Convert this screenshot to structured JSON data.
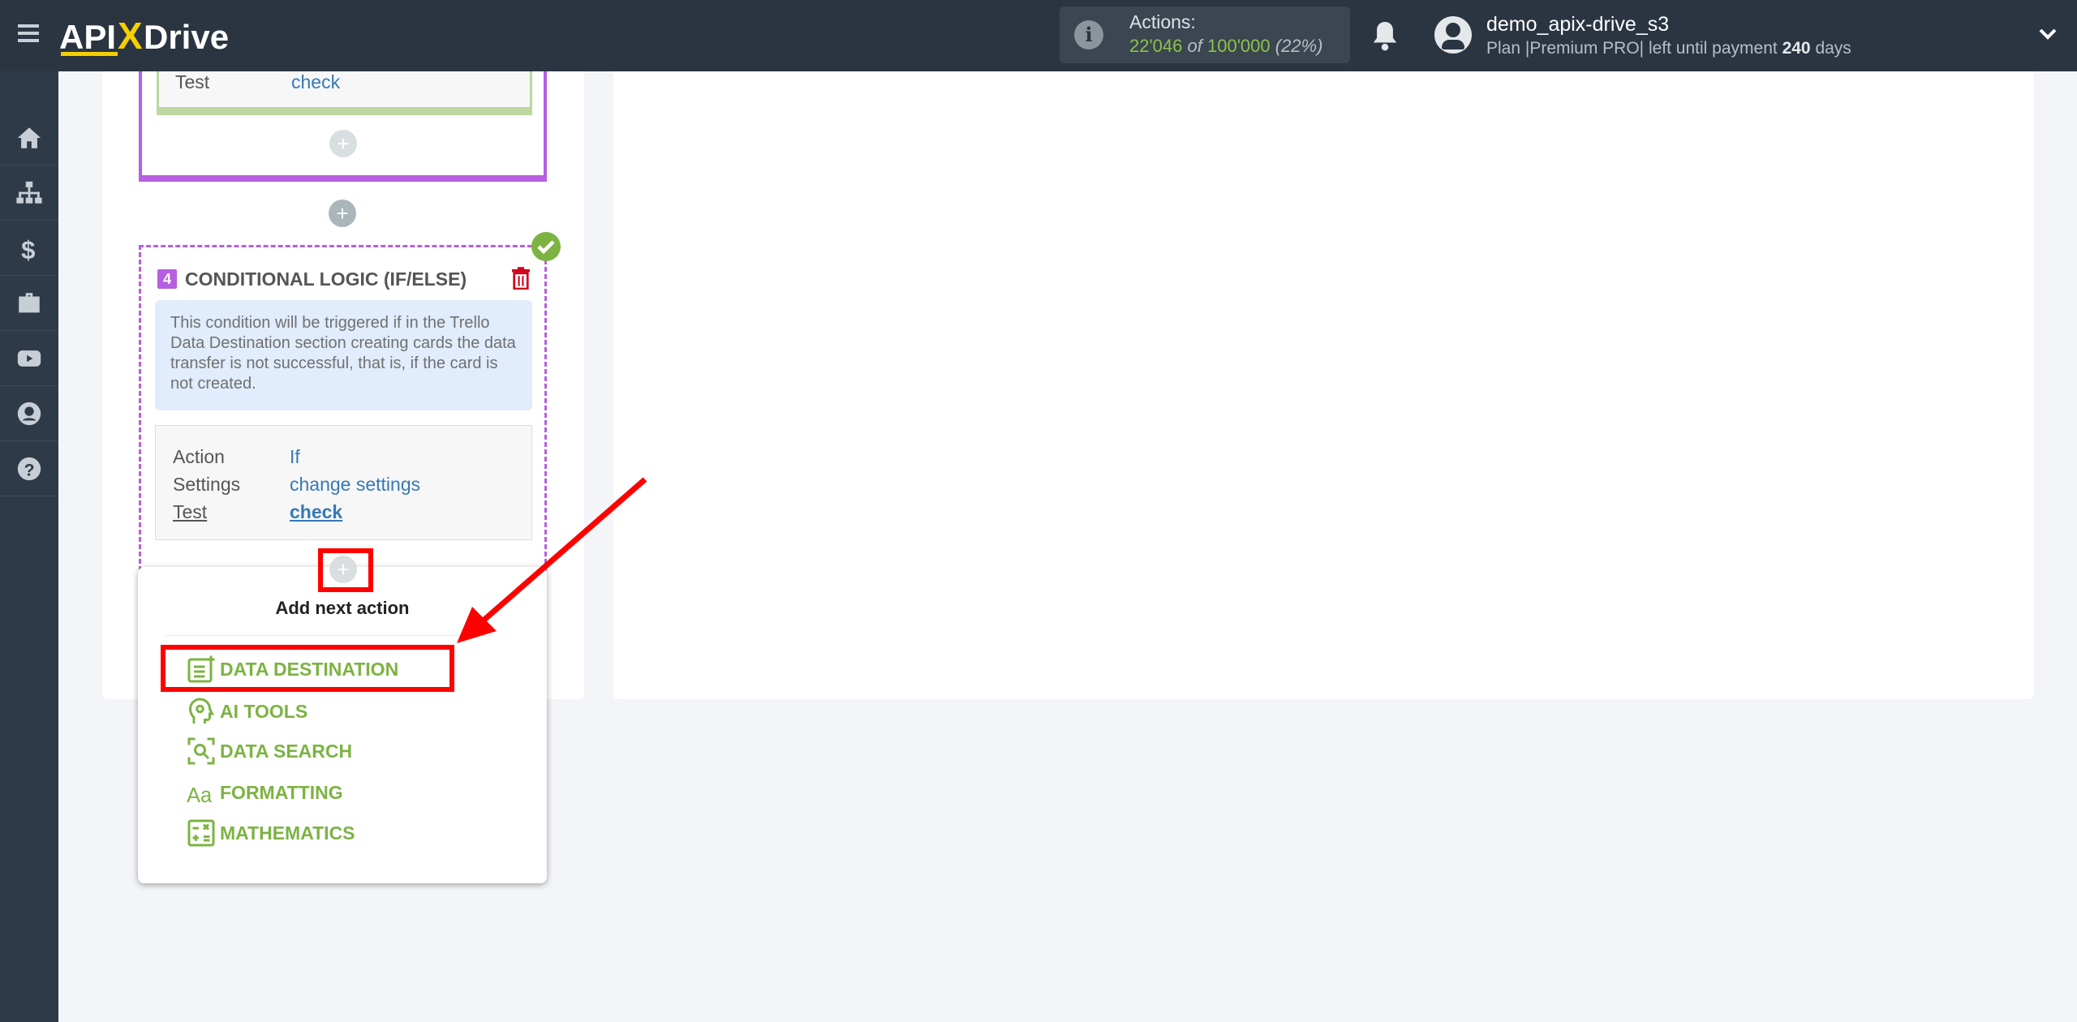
{
  "header": {
    "logo": "APIXDrive",
    "actions_label": "Actions:",
    "actions_used": "22'046",
    "actions_of": "of",
    "actions_total": "100'000",
    "actions_pct": "(22%)",
    "username": "demo_apix-drive_s3",
    "plan_prefix": "Plan |Premium PRO| left until payment",
    "plan_days": "240",
    "plan_suffix": "days"
  },
  "sidebar": {
    "items": [
      "home",
      "sitemap",
      "billing",
      "briefcase",
      "youtube",
      "account",
      "help"
    ]
  },
  "prev_block": {
    "test_label": "Test",
    "test_value": "check"
  },
  "block": {
    "number": "4",
    "title": "CONDITIONAL LOGIC (IF/ELSE)",
    "description": "This condition will be triggered if in the Trello Data Destination section creating cards the data transfer is not successful, that is, if the card is not created.",
    "rows": [
      {
        "label": "Action",
        "value": "If"
      },
      {
        "label": "Settings",
        "value": "change settings"
      },
      {
        "label": "Test",
        "value": "check"
      }
    ]
  },
  "popup": {
    "title": "Add next action",
    "items": [
      {
        "label": "DATA DESTINATION",
        "icon": "data-destination-icon"
      },
      {
        "label": "AI TOOLS",
        "icon": "ai-tools-icon"
      },
      {
        "label": "DATA SEARCH",
        "icon": "data-search-icon"
      },
      {
        "label": "FORMATTING",
        "icon": "formatting-icon"
      },
      {
        "label": "MATHEMATICS",
        "icon": "mathematics-icon"
      }
    ]
  },
  "colors": {
    "header": "#2b3542",
    "accent_green": "#7cb342",
    "purple": "#b65fe0",
    "annotation_red": "#ff0000",
    "link": "#3579b7"
  }
}
